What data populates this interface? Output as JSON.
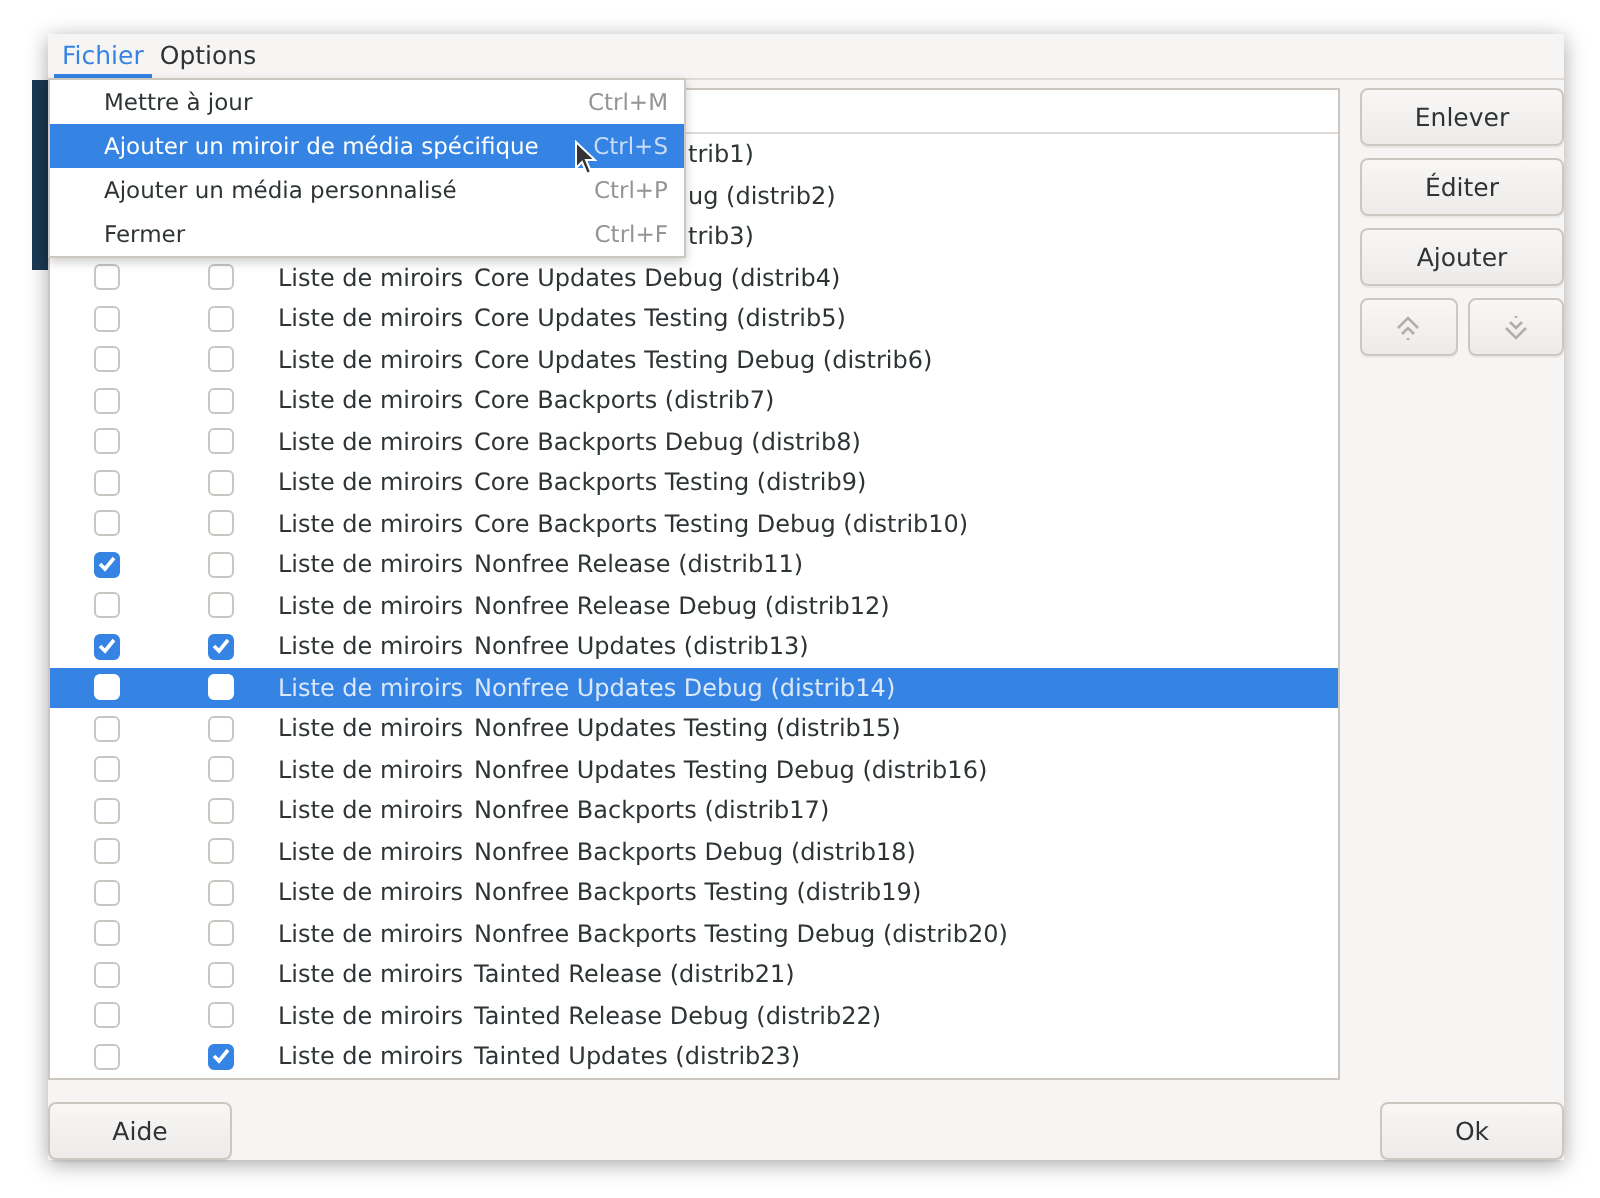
{
  "menubar": [
    {
      "label": "Fichier",
      "selected": true
    },
    {
      "label": "Options",
      "selected": false
    }
  ],
  "menu": [
    {
      "label": "Mettre à jour",
      "shortcut": "Ctrl+M",
      "selected": false
    },
    {
      "label": "Ajouter un miroir de média spécifique",
      "shortcut": "Ctrl+S",
      "selected": true
    },
    {
      "label": "Ajouter un média personnalisé",
      "shortcut": "Ctrl+P",
      "selected": false
    },
    {
      "label": "Fermer",
      "shortcut": "Ctrl+F",
      "selected": false
    }
  ],
  "table": {
    "rows": [
      {
        "kind": "covered",
        "tail": "trib1)",
        "selected": false
      },
      {
        "kind": "covered",
        "tail": "ug (distrib2)",
        "selected": false
      },
      {
        "kind": "covered",
        "tail": "trib3)",
        "selected": false
      },
      {
        "kind": "full",
        "checked_1": false,
        "checked_2": false,
        "type": "Liste de miroirs",
        "name": "Core Updates Debug (distrib4)",
        "selected": false
      },
      {
        "kind": "full",
        "checked_1": false,
        "checked_2": false,
        "type": "Liste de miroirs",
        "name": "Core Updates Testing (distrib5)",
        "selected": false
      },
      {
        "kind": "full",
        "checked_1": false,
        "checked_2": false,
        "type": "Liste de miroirs",
        "name": "Core Updates Testing Debug (distrib6)",
        "selected": false
      },
      {
        "kind": "full",
        "checked_1": false,
        "checked_2": false,
        "type": "Liste de miroirs",
        "name": "Core Backports (distrib7)",
        "selected": false
      },
      {
        "kind": "full",
        "checked_1": false,
        "checked_2": false,
        "type": "Liste de miroirs",
        "name": "Core Backports Debug (distrib8)",
        "selected": false
      },
      {
        "kind": "full",
        "checked_1": false,
        "checked_2": false,
        "type": "Liste de miroirs",
        "name": "Core Backports Testing (distrib9)",
        "selected": false
      },
      {
        "kind": "full",
        "checked_1": false,
        "checked_2": false,
        "type": "Liste de miroirs",
        "name": "Core Backports Testing Debug (distrib10)",
        "selected": false
      },
      {
        "kind": "full",
        "checked_1": true,
        "checked_2": false,
        "type": "Liste de miroirs",
        "name": "Nonfree Release (distrib11)",
        "selected": false
      },
      {
        "kind": "full",
        "checked_1": false,
        "checked_2": false,
        "type": "Liste de miroirs",
        "name": "Nonfree Release Debug (distrib12)",
        "selected": false
      },
      {
        "kind": "full",
        "checked_1": true,
        "checked_2": true,
        "type": "Liste de miroirs",
        "name": "Nonfree Updates (distrib13)",
        "selected": false
      },
      {
        "kind": "full",
        "checked_1": false,
        "checked_2": false,
        "type": "Liste de miroirs",
        "name": "Nonfree Updates Debug (distrib14)",
        "selected": true
      },
      {
        "kind": "full",
        "checked_1": false,
        "checked_2": false,
        "type": "Liste de miroirs",
        "name": "Nonfree Updates Testing (distrib15)",
        "selected": false
      },
      {
        "kind": "full",
        "checked_1": false,
        "checked_2": false,
        "type": "Liste de miroirs",
        "name": "Nonfree Updates Testing Debug (distrib16)",
        "selected": false
      },
      {
        "kind": "full",
        "checked_1": false,
        "checked_2": false,
        "type": "Liste de miroirs",
        "name": "Nonfree Backports (distrib17)",
        "selected": false
      },
      {
        "kind": "full",
        "checked_1": false,
        "checked_2": false,
        "type": "Liste de miroirs",
        "name": "Nonfree Backports Debug (distrib18)",
        "selected": false
      },
      {
        "kind": "full",
        "checked_1": false,
        "checked_2": false,
        "type": "Liste de miroirs",
        "name": "Nonfree Backports Testing (distrib19)",
        "selected": false
      },
      {
        "kind": "full",
        "checked_1": false,
        "checked_2": false,
        "type": "Liste de miroirs",
        "name": "Nonfree Backports Testing Debug (distrib20)",
        "selected": false
      },
      {
        "kind": "full",
        "checked_1": false,
        "checked_2": false,
        "type": "Liste de miroirs",
        "name": "Tainted Release (distrib21)",
        "selected": false
      },
      {
        "kind": "full",
        "checked_1": false,
        "checked_2": false,
        "type": "Liste de miroirs",
        "name": "Tainted Release Debug (distrib22)",
        "selected": false
      },
      {
        "kind": "full",
        "checked_1": false,
        "checked_2": true,
        "type": "Liste de miroirs",
        "name": "Tainted Updates (distrib23)",
        "selected": false
      }
    ]
  },
  "side_buttons": [
    {
      "label": "Enlever"
    },
    {
      "label": "Éditer"
    },
    {
      "label": "Ajouter"
    }
  ],
  "bottom_buttons": [
    {
      "label": "Aide"
    },
    {
      "label": "Ok"
    }
  ]
}
